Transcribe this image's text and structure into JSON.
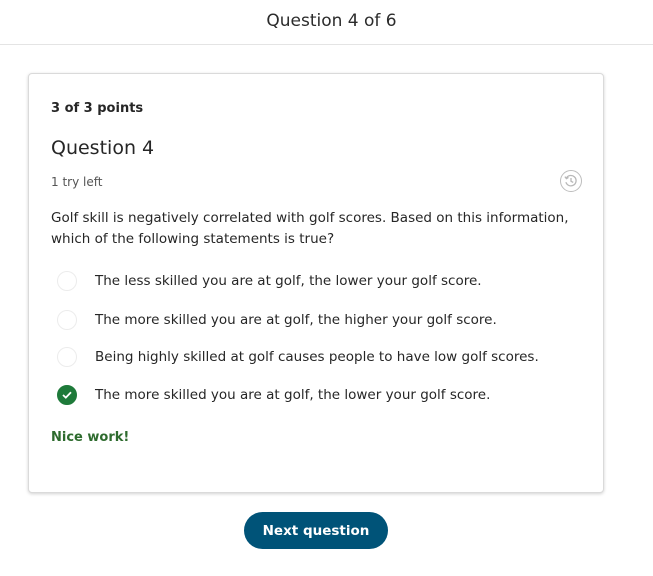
{
  "header": {
    "title": "Question 4 of 6"
  },
  "card": {
    "points": "3 of 3 points",
    "question_title": "Question 4",
    "tries_left": "1 try left",
    "history_icon": "history-icon",
    "prompt": "Golf skill is negatively correlated with golf scores. Based on this information, which of the following statements is true?",
    "options": [
      {
        "label": "The less skilled you are at golf, the lower your golf score.",
        "selected": false
      },
      {
        "label": "The more skilled you are at golf, the higher your golf score.",
        "selected": false
      },
      {
        "label": "Being highly skilled at golf causes people to have low golf scores.",
        "selected": false
      },
      {
        "label": "The more skilled you are at golf, the lower your golf score.",
        "selected": true
      }
    ],
    "feedback": "Nice work!"
  },
  "footer": {
    "next_label": "Next question"
  },
  "colors": {
    "accent": "#005378",
    "success": "#1e7a3a",
    "feedback_text": "#2e6b2e"
  }
}
